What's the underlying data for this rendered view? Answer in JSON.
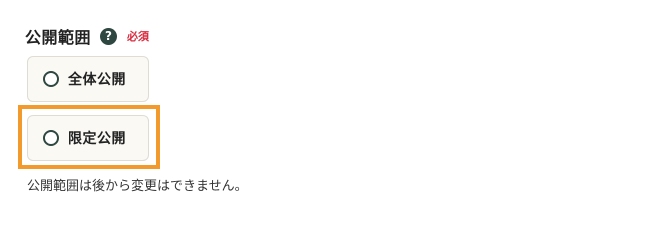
{
  "field": {
    "label": "公開範囲",
    "help_icon": "question-circle-icon",
    "help_glyph": "?",
    "required": "必須"
  },
  "options": [
    {
      "label": "全体公開",
      "selected": false
    },
    {
      "label": "限定公開",
      "selected": false
    }
  ],
  "note": "公開範囲は後から変更はできません。",
  "colors": {
    "accent_dark": "#2f4741",
    "required_red": "#d92b3f",
    "highlight_orange": "#f39a2c"
  }
}
